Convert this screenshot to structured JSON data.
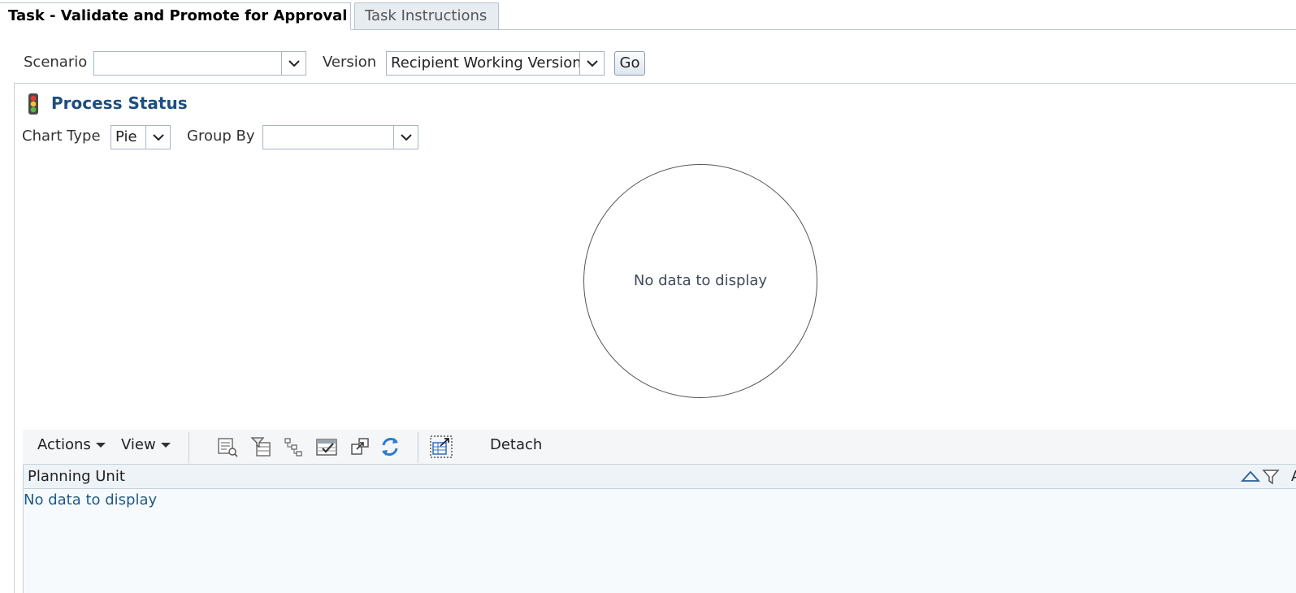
{
  "tabs": [
    {
      "label": "Task - Validate and Promote for Approval",
      "active": true
    },
    {
      "label": "Task Instructions",
      "active": false
    }
  ],
  "filters": {
    "scenario_label": "Scenario",
    "scenario_value": "",
    "version_label": "Version",
    "version_value": "Recipient Working Version",
    "go_label": "Go"
  },
  "process_status": {
    "title": "Process Status",
    "icon": "traffic-light-icon",
    "chart_type_label": "Chart Type",
    "chart_type_value": "Pie",
    "group_by_label": "Group By",
    "group_by_value": "",
    "chart_message": "No data to display"
  },
  "chart_data": {
    "type": "pie",
    "values": [],
    "categories": []
  },
  "toolbar": {
    "actions_label": "Actions",
    "view_label": "View",
    "detach_label": "Detach",
    "icons": [
      "query-by-example-icon",
      "filter-table-icon",
      "hierarchy-icon",
      "approve-icon",
      "export-icon",
      "refresh-icon",
      "detach-icon"
    ]
  },
  "table": {
    "columns": [
      {
        "label": "Planning Unit"
      },
      {
        "label": "A"
      }
    ],
    "empty_message": "No data to display"
  },
  "colors": {
    "title": "#1c4e80",
    "link_text": "#1c5a88",
    "header_bg": "#eef3f8"
  }
}
